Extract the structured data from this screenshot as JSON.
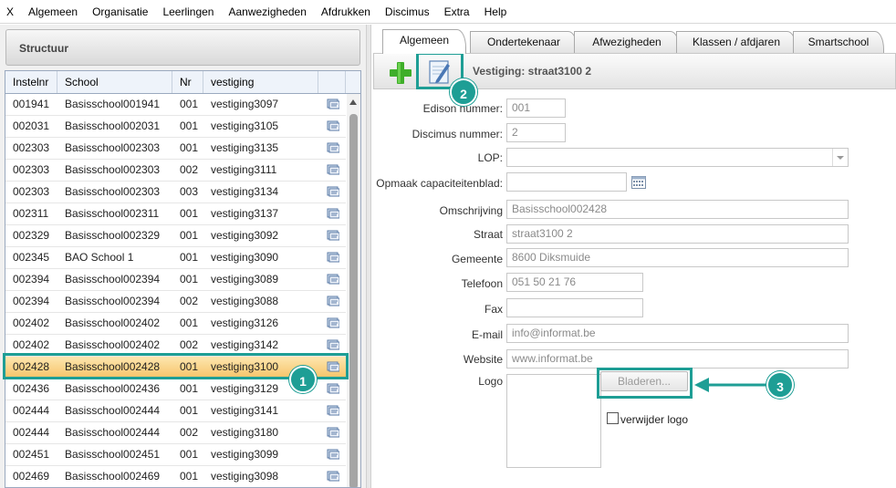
{
  "menu": [
    "X",
    "Algemeen",
    "Organisatie",
    "Leerlingen",
    "Aanwezigheden",
    "Afdrukken",
    "Discimus",
    "Extra",
    "Help"
  ],
  "left": {
    "structuur_label": "Structuur",
    "columns": [
      "Instelnr",
      "School",
      "Nr",
      "vestiging"
    ],
    "rows": [
      {
        "instelnr": "001941",
        "school": "Basisschool001941",
        "nr": "001",
        "vestiging": "vestiging3097"
      },
      {
        "instelnr": "002031",
        "school": "Basisschool002031",
        "nr": "001",
        "vestiging": "vestiging3105"
      },
      {
        "instelnr": "002303",
        "school": "Basisschool002303",
        "nr": "001",
        "vestiging": "vestiging3135"
      },
      {
        "instelnr": "002303",
        "school": "Basisschool002303",
        "nr": "002",
        "vestiging": "vestiging3111"
      },
      {
        "instelnr": "002303",
        "school": "Basisschool002303",
        "nr": "003",
        "vestiging": "vestiging3134"
      },
      {
        "instelnr": "002311",
        "school": "Basisschool002311",
        "nr": "001",
        "vestiging": "vestiging3137"
      },
      {
        "instelnr": "002329",
        "school": "Basisschool002329",
        "nr": "001",
        "vestiging": "vestiging3092"
      },
      {
        "instelnr": "002345",
        "school": "BAO School 1",
        "nr": "001",
        "vestiging": "vestiging3090"
      },
      {
        "instelnr": "002394",
        "school": "Basisschool002394",
        "nr": "001",
        "vestiging": "vestiging3089"
      },
      {
        "instelnr": "002394",
        "school": "Basisschool002394",
        "nr": "002",
        "vestiging": "vestiging3088"
      },
      {
        "instelnr": "002402",
        "school": "Basisschool002402",
        "nr": "001",
        "vestiging": "vestiging3126"
      },
      {
        "instelnr": "002402",
        "school": "Basisschool002402",
        "nr": "002",
        "vestiging": "vestiging3142"
      },
      {
        "instelnr": "002428",
        "school": "Basisschool002428",
        "nr": "001",
        "vestiging": "vestiging3100"
      },
      {
        "instelnr": "002436",
        "school": "Basisschool002436",
        "nr": "001",
        "vestiging": "vestiging3129"
      },
      {
        "instelnr": "002444",
        "school": "Basisschool002444",
        "nr": "001",
        "vestiging": "vestiging3141"
      },
      {
        "instelnr": "002444",
        "school": "Basisschool002444",
        "nr": "002",
        "vestiging": "vestiging3180"
      },
      {
        "instelnr": "002451",
        "school": "Basisschool002451",
        "nr": "001",
        "vestiging": "vestiging3099"
      },
      {
        "instelnr": "002469",
        "school": "Basisschool002469",
        "nr": "001",
        "vestiging": "vestiging3098"
      }
    ],
    "selected_row": 12
  },
  "tabs": [
    "Algemeen",
    "Ondertekenaar",
    "Afwezigheden",
    "Klassen / afdjaren",
    "Smartschool"
  ],
  "active_tab": 0,
  "toolbar": {
    "title": "Vestiging: straat3100 2"
  },
  "form": {
    "edison_label": "Edison nummer:",
    "edison_value": "001",
    "discimus_label": "Discimus nummer:",
    "discimus_value": "2",
    "lop_label": "LOP:",
    "lop_value": "",
    "opmaak_label": "Opmaak capaciteitenblad:",
    "opmaak_value": "",
    "omschrijving_label": "Omschrijving",
    "omschrijving_value": "Basisschool002428",
    "straat_label": "Straat",
    "straat_value": "straat3100 2",
    "gemeente_label": "Gemeente",
    "gemeente_value": "8600 Diksmuide",
    "telefoon_label": "Telefoon",
    "telefoon_value": "051 50 21 76",
    "fax_label": "Fax",
    "fax_value": "",
    "email_label": "E-mail",
    "email_value": "info@informat.be",
    "website_label": "Website",
    "website_value": "www.informat.be",
    "logo_label": "Logo",
    "bladeren_label": "Bladeren...",
    "verwijder_label": "verwijder logo"
  },
  "annotations": [
    "1",
    "2",
    "3"
  ],
  "colors": {
    "accent": "#1e9e95",
    "selected_row": "#f7c46a"
  }
}
